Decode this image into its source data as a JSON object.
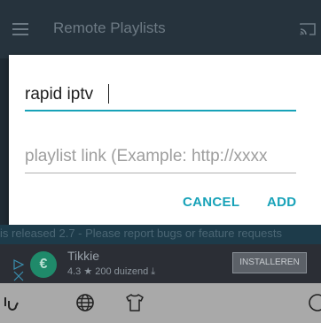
{
  "appbar": {
    "title": "Remote Playlists",
    "menu_icon": "hamburger-menu-icon",
    "cast_icon": "cast-icon"
  },
  "dialog": {
    "name_value": "rapid iptv",
    "link_placeholder": "playlist link (Example: http://xxxx",
    "cancel_label": "CANCEL",
    "add_label": "ADD",
    "accent_color": "#17a2b8"
  },
  "notice": {
    "text": "is released 2.7 - Please report bugs or feature requests"
  },
  "ad": {
    "app_name": "Tikkie",
    "rating": "4.3 ★  200 duizend ⤓",
    "install_label": "INSTALLEREN",
    "logo_letter": "€"
  },
  "keyboard": {
    "icons": [
      "gif-icon",
      "globe-icon",
      "shirt-icon",
      "emoji-icon"
    ]
  }
}
